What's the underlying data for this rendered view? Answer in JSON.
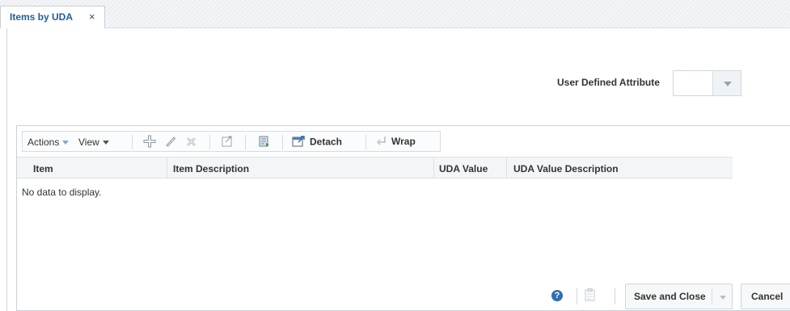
{
  "tab": {
    "label": "Items by UDA",
    "close": "×"
  },
  "uda_field": {
    "label": "User Defined Attribute",
    "value": ""
  },
  "toolbar": {
    "actions_label": "Actions",
    "view_label": "View",
    "detach_label": "Detach",
    "wrap_label": "Wrap",
    "icons": [
      "add-icon",
      "edit-icon",
      "delete-icon",
      "export-icon",
      "import-icon",
      "detach-icon",
      "wrap-icon"
    ]
  },
  "table": {
    "columns": [
      "Item",
      "Item Description",
      "UDA Value",
      "UDA Value Description"
    ],
    "empty_text": "No data to display."
  },
  "footer": {
    "help": "?",
    "save_close_label": "Save and Close",
    "cancel_label": "Cancel"
  },
  "colors": {
    "tab_text": "#1f5f99",
    "help_icon": "#2e6fb5"
  }
}
